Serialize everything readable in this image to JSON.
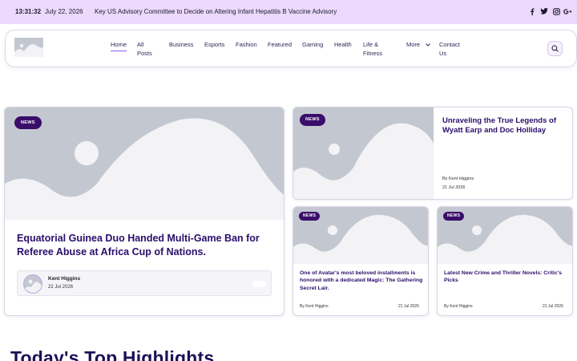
{
  "topbar": {
    "time": "13:31:32",
    "date": "July 22, 2026",
    "ticker": "Key US Advisory Committee to Decide on Altering Infant Hepatitis B Vaccine Advisory",
    "social_icons": [
      "facebook-icon",
      "twitter-icon",
      "instagram-icon",
      "google-plus-icon"
    ]
  },
  "nav": {
    "home": "Home",
    "all_posts_1": "All",
    "all_posts_2": "Posts",
    "business": "Business",
    "esports": "Esports",
    "fashion": "Fashion",
    "featured": "Featured",
    "gaming": "Gaming",
    "health": "Health",
    "life_1": "Life &",
    "life_2": "Fitness",
    "more": "More",
    "contact_1": "Contact",
    "contact_2": "Us"
  },
  "featured": {
    "badge": "NEWS",
    "title": "Equatorial Guinea Duo Handed Multi-Game Ban for Referee Abuse at Africa Cup of Nations.",
    "author": "Kent Higgins",
    "date": "22 Jul 2026"
  },
  "side_top": {
    "badge": "NEWS",
    "title": "Unraveling the True Legends of Wyatt Earp and Doc Holliday",
    "byline": "By Kent Higgins",
    "date": "21 Jul 2026"
  },
  "small_1": {
    "badge": "NEWS",
    "title": "One of Avatar's most beloved installments is honored with a dedicated Magic: The Gathering Secret Lair.",
    "byline": "By Kent Higgins",
    "date": "21 Jul 2026"
  },
  "small_2": {
    "badge": "NEWS",
    "title": "Latest New Crime and Thriller Novels: Critic's Picks",
    "byline": "By Kent Higgins",
    "date": "21 Jul 2026"
  },
  "section": {
    "title": "Today's Top Highlights"
  },
  "colors": {
    "topbar_bg": "#ecd9fb",
    "badge_bg": "#3b0d6b",
    "title_color": "#2a0e6b",
    "placeholder_bg": "#c3c8d0"
  }
}
